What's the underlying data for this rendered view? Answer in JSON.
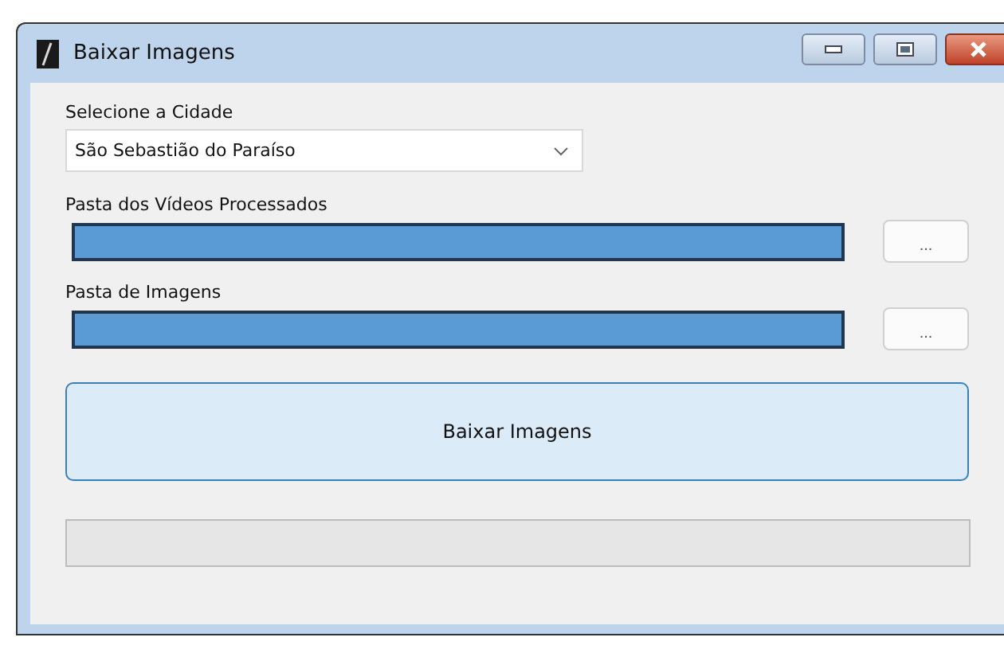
{
  "window": {
    "title": "Baixar Imagens"
  },
  "city": {
    "label": "Selecione a Cidade",
    "value": "São Sebastião do Paraíso"
  },
  "folders": [
    {
      "label": "Pasta dos Vídeos Processados",
      "button": "..."
    },
    {
      "label": "Pasta de Imagens",
      "button": "..."
    }
  ],
  "action_button": "Baixar Imagens",
  "progress": {
    "level": 0
  }
}
